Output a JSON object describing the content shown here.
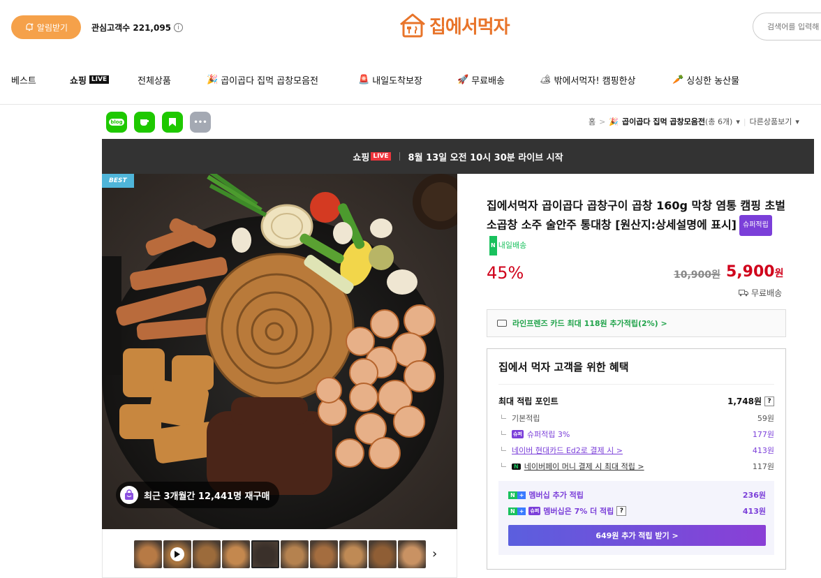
{
  "header": {
    "alarm_label": "알림받기",
    "interest_label": "관심고객수 221,095",
    "info_glyph": "i",
    "logo_text": "집에서먹자",
    "search_placeholder": "검색어를 입력해"
  },
  "nav": {
    "items": [
      {
        "label": "베스트"
      },
      {
        "label": "쇼핑",
        "badge": "LIVE"
      },
      {
        "label": "전체상품"
      },
      {
        "label": "곱이곱다 집먹 곱창모음전"
      },
      {
        "label": "내일도착보장"
      },
      {
        "label": "무료배송"
      },
      {
        "label": "밖에서먹자! 캠핑한상"
      },
      {
        "label": "싱싱한 농산물"
      }
    ]
  },
  "share": {
    "blog": "blog",
    "more": "•••"
  },
  "breadcrumb": {
    "home": "홈",
    "sep": ">",
    "category": "곱이곱다 집먹 곱창모음전",
    "count": "(총 6개)",
    "other": "다른상품보기"
  },
  "live_banner": {
    "brand": "쇼핑",
    "badge": "LIVE",
    "text": "8월 13일 오전 10시 30분 라이브 시작"
  },
  "image": {
    "best_tag": "BEST",
    "repurchase_text": "최근 3개월간 12,441명 재구매"
  },
  "thumbnails": {
    "count": 10,
    "active_index": 4,
    "video_index": 1,
    "next": "›"
  },
  "product": {
    "title": "집에서먹자 곱이곱다 곱창구이 곱창 160g 막창 염통 캠핑 초벌 소곱창 소주 술안주 통대창 [원산지:상세설명에 표시]",
    "super_badge": "슈퍼적립",
    "tomorrow_n": "N",
    "tomorrow_label": "내일배송",
    "discount": "45%",
    "original_price": "10,900원",
    "sale_price": "5,900",
    "sale_unit": "원",
    "shipping": "무료배송"
  },
  "card_offer": {
    "text": "라인프렌즈 카드 최대 118원 추가적립(2%) >"
  },
  "benefits": {
    "title": "집에서 먹자 고객을 위한 혜택",
    "max_point_label": "최대 적립 포인트",
    "max_point_value": "1,748원",
    "qmark": "?",
    "rows": [
      {
        "label": "기본적립",
        "value": "59원"
      },
      {
        "chip": "슈퍼",
        "label": "슈퍼적립 3%",
        "value": "177원"
      },
      {
        "label": "네이버 현대카드 Ed2로 결제 시 >",
        "value": "413원"
      },
      {
        "chip": "N",
        "label": "네이버페이 머니 결제 시 최대 적립 >",
        "value": "117원"
      }
    ],
    "member": {
      "row1_label": "멤버십 추가 적립",
      "row1_value": "236원",
      "row2_label": "멤버십은 7% 더 적립",
      "row2_value": "413원",
      "n_chip": "N",
      "plus_chip": "+",
      "super_chip": "슈퍼",
      "button_label": "649원 추가 적립 받기 >"
    }
  },
  "colors": {
    "brand_orange": "#e8742a",
    "alarm_orange": "#f5a14a",
    "price_red": "#d0021b",
    "super_purple": "#7b3fd9",
    "naver_green": "#19c15d"
  }
}
